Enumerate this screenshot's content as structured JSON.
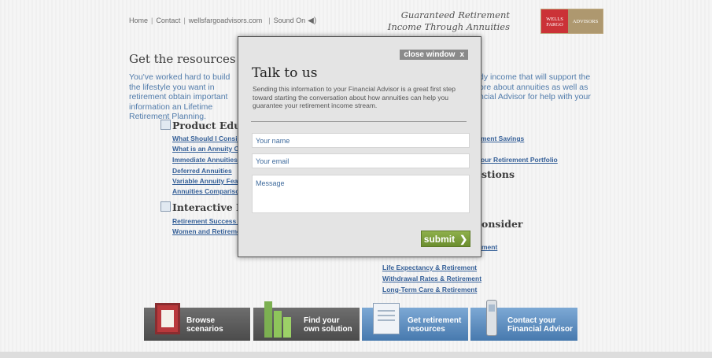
{
  "nav": {
    "home": "Home",
    "contact": "Contact",
    "site": "wellsfargoadvisors.com",
    "sound": "Sound On"
  },
  "tagline": "Guaranteed Retirement Income Through Annuities",
  "logo": {
    "left": "WELLS FARGO",
    "right": "ADVISORS"
  },
  "heading": "Get the resources you",
  "intro": {
    "left": "You've worked hard to build the lifestyle you want in retirement obtain important information an Lifetime Retirement Planning.",
    "right": "dy income that will support the ore about annuities as well as ncial Advisor for help with your"
  },
  "sections": {
    "product": "Product Educa",
    "interactive": "Interactive Ret",
    "questions": "stions",
    "consider": "onsider"
  },
  "links_left": [
    "What Should I Conside",
    "What is an Annuity Co",
    "Immediate Annuities",
    "Deferred Annuities",
    "Variable Annuity Feat",
    "Annuities Comparisor",
    "Retirement Success –",
    "Women and Retireme"
  ],
  "links_right_top": [
    "ment Savings",
    "our Retirement Portfolio"
  ],
  "links_right_bottom": [
    "ment",
    "Life Expectancy & Retirement",
    "Withdrawal Rates & Retirement",
    "Long-Term Care & Retirement"
  ],
  "tiles": [
    {
      "label": "Browse\nscenarios"
    },
    {
      "label": "Find your\nown solution"
    },
    {
      "label": "Get retirement\nresources"
    },
    {
      "label": "Contact your\nFinancial Advisor"
    }
  ],
  "modal": {
    "close": "close window",
    "close_x": "x",
    "title": "Talk to us",
    "description": "Sending this information to your Financial Advisor is a great first step toward starting the conversation about how annuities can help you guarantee your retirement income stream.",
    "name_placeholder": "Your name",
    "email_placeholder": "Your email",
    "message_placeholder": "Message",
    "submit": "submit"
  }
}
